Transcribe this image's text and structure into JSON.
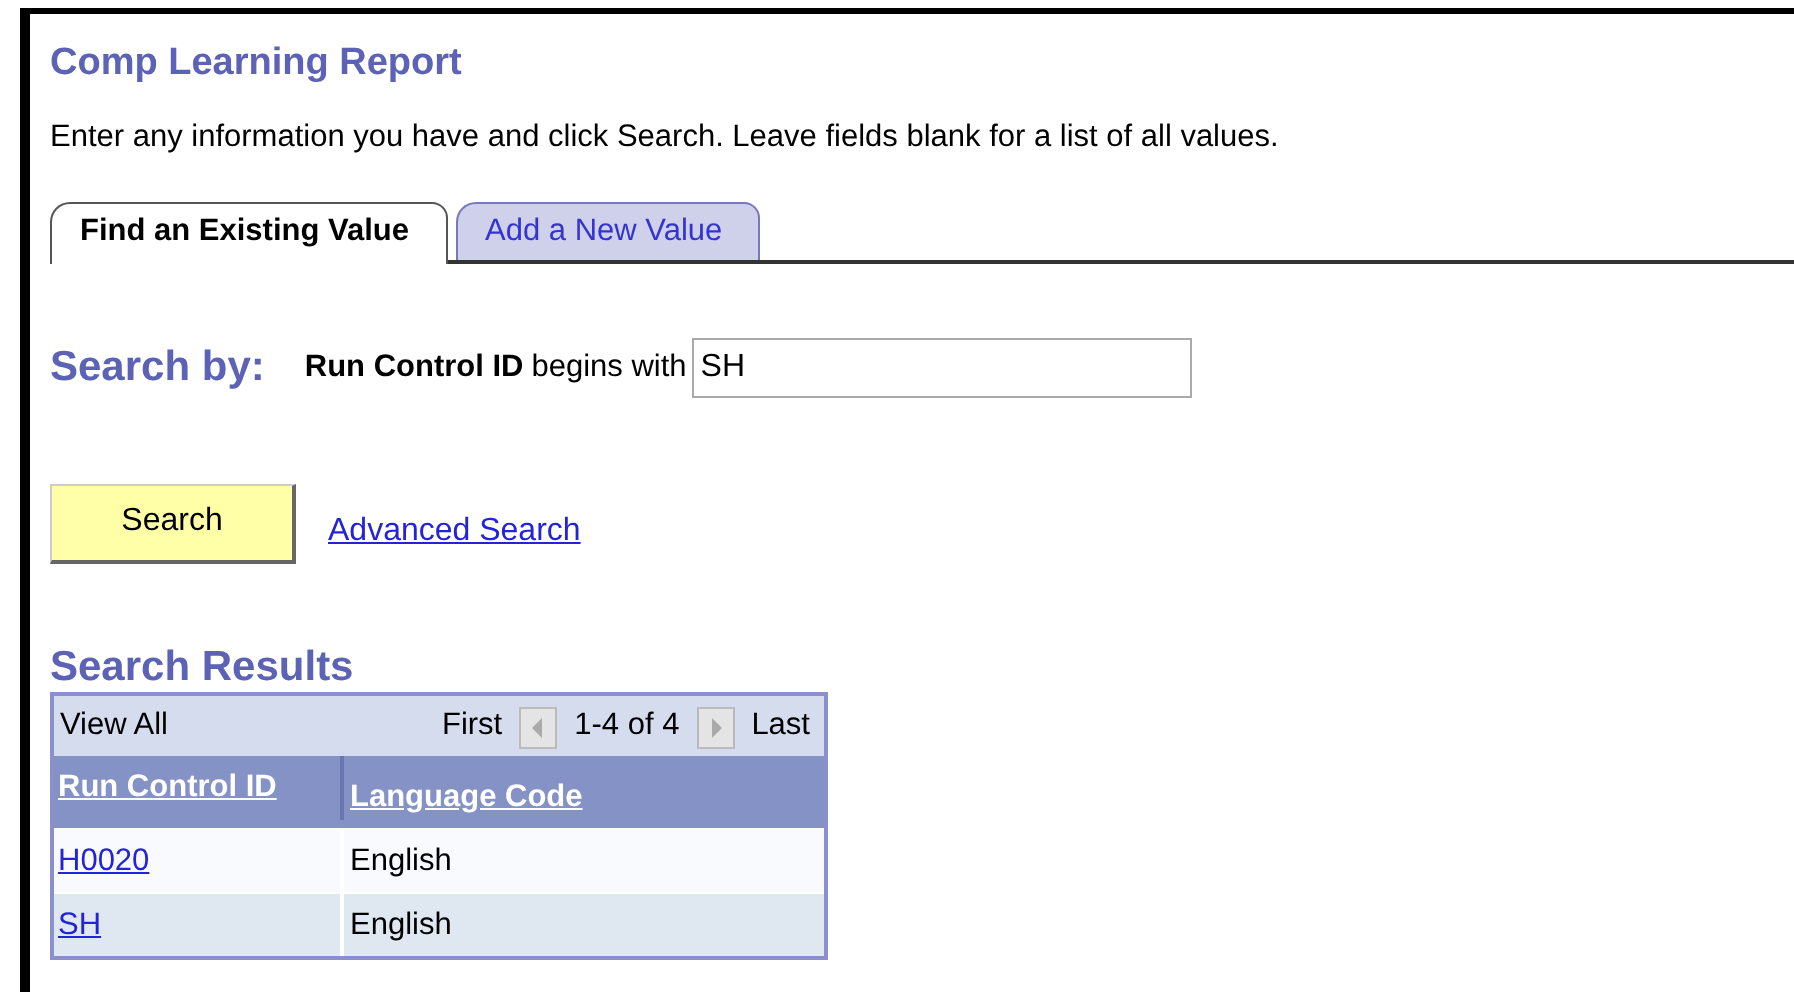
{
  "page": {
    "title": "Comp Learning Report",
    "instructions": "Enter any information you have and click Search. Leave fields blank for a list of all values."
  },
  "tabs": [
    {
      "label": "Find an Existing Value",
      "selected": true
    },
    {
      "label": "Add a New Value",
      "selected": false
    }
  ],
  "search": {
    "heading": "Search by:",
    "field_label": "Run Control ID",
    "operator": "begins with",
    "value": "SH",
    "button": "Search",
    "advanced_link": "Advanced Search"
  },
  "results": {
    "heading": "Search Results",
    "view_all": "View All",
    "first": "First",
    "range": "1-4 of 4",
    "last": "Last",
    "columns": [
      "Run Control ID",
      "Language Code"
    ],
    "rows": [
      {
        "id": "H0020",
        "language": "English"
      },
      {
        "id": "SH",
        "language": "English"
      }
    ]
  }
}
